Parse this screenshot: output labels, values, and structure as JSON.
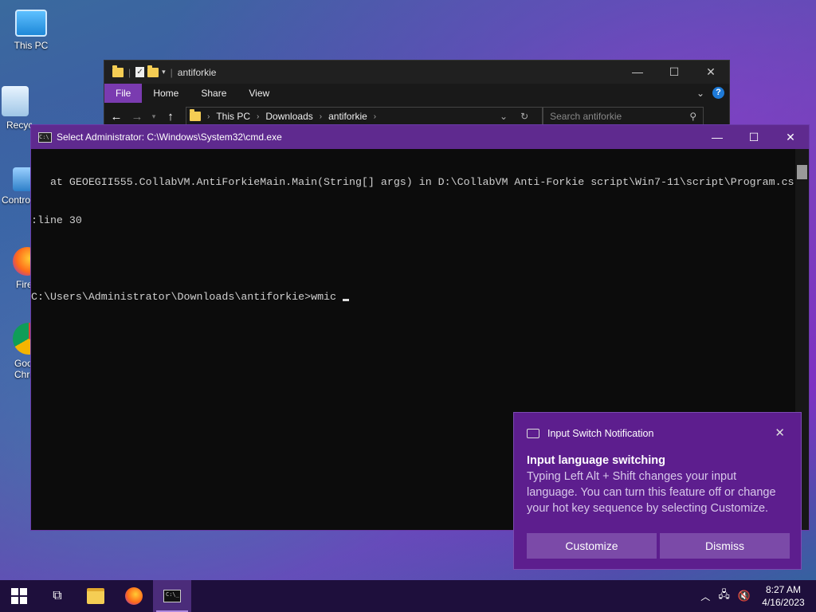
{
  "desktop": {
    "icons": [
      {
        "label": "This PC",
        "icon": "this-pc-icon"
      },
      {
        "label": "Recyc",
        "icon": "recycle-bin-icon"
      },
      {
        "label": "Contro",
        "icon": "control-panel-icon"
      },
      {
        "label": "Fire",
        "icon": "firefox-icon"
      },
      {
        "label": "Goo\nChro",
        "icon": "chrome-icon"
      }
    ]
  },
  "explorer": {
    "title": "antiforkie",
    "tabs": [
      "File",
      "Home",
      "Share",
      "View"
    ],
    "path": [
      "This PC",
      "Downloads",
      "antiforkie"
    ],
    "search_placeholder": "Search antiforkie",
    "controls": {
      "minimize": "—",
      "maximize": "☐",
      "close": "✕"
    }
  },
  "cmd": {
    "title": "Select Administrator: C:\\Windows\\System32\\cmd.exe",
    "lines": [
      "   at GEOEGII555.CollabVM.AntiForkieMain.Main(String[] args) in D:\\CollabVM Anti-Forkie script\\Win7-11\\script\\Program.cs",
      ":line 30",
      "",
      "C:\\Users\\Administrator\\Downloads\\antiforkie>wmic"
    ],
    "controls": {
      "minimize": "—",
      "maximize": "☐",
      "close": "✕"
    }
  },
  "toast": {
    "app": "Input Switch Notification",
    "title": "Input language switching",
    "body": "Typing Left Alt + Shift changes your input language. You can turn this feature off or change your hot key sequence by selecting Customize.",
    "buttons": {
      "customize": "Customize",
      "dismiss": "Dismiss"
    },
    "close": "✕"
  },
  "taskbar": {
    "time": "8:27 AM",
    "date": "4/16/2023",
    "accent": "#5f2a8f"
  }
}
